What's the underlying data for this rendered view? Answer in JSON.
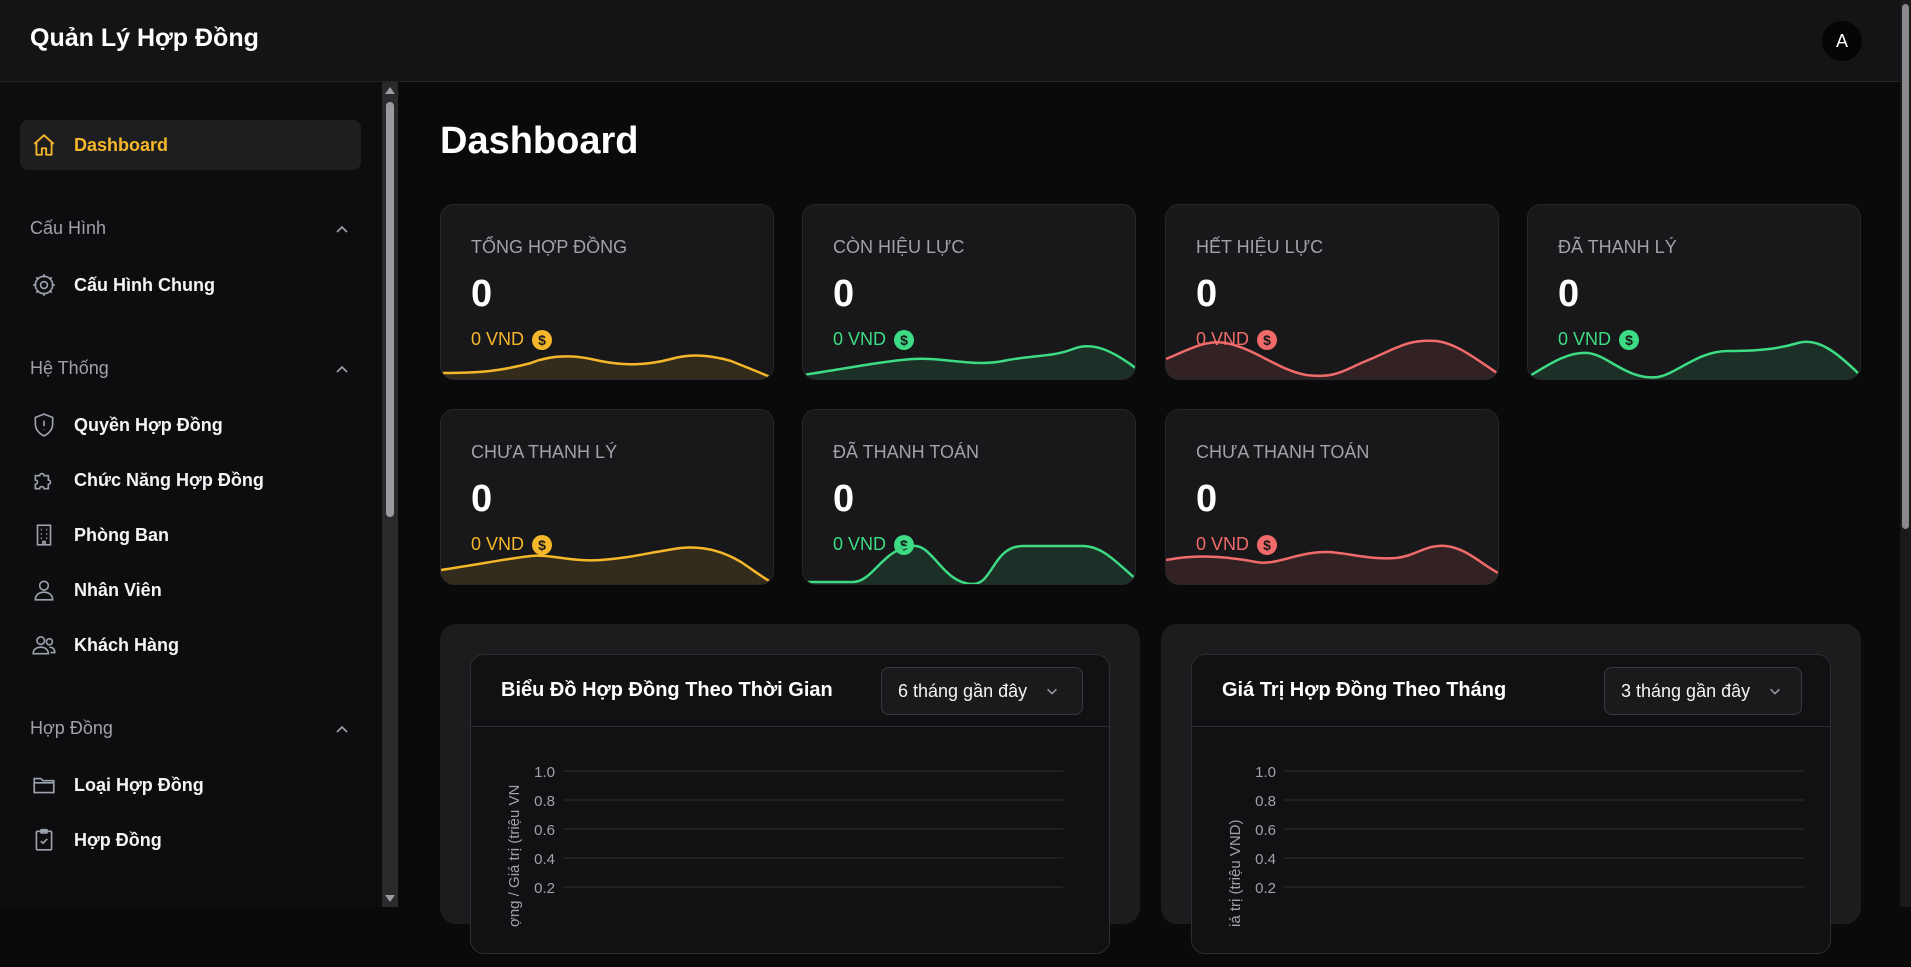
{
  "app": {
    "title": "Quản Lý Hợp Đồng",
    "avatar_initial": "A"
  },
  "sidebar": {
    "dashboard": {
      "label": "Dashboard",
      "icon": "home-icon"
    },
    "sections": [
      {
        "title": "Cấu Hình",
        "items": [
          {
            "label": "Cấu Hình Chung",
            "icon": "gear-icon"
          }
        ]
      },
      {
        "title": "Hệ Thống",
        "items": [
          {
            "label": "Quyền Hợp Đồng",
            "icon": "shield-icon"
          },
          {
            "label": "Chức Năng Hợp Đồng",
            "icon": "puzzle-icon"
          },
          {
            "label": "Phòng Ban",
            "icon": "building-icon"
          },
          {
            "label": "Nhân Viên",
            "icon": "user-icon"
          },
          {
            "label": "Khách Hàng",
            "icon": "users-icon"
          }
        ]
      },
      {
        "title": "Hợp Đồng",
        "items": [
          {
            "label": "Loại Hợp Đồng",
            "icon": "folder-icon"
          },
          {
            "label": "Hợp Đồng",
            "icon": "clipboard-check-icon"
          }
        ]
      }
    ]
  },
  "main": {
    "title": "Dashboard"
  },
  "colors": {
    "accent": "#f5b72a",
    "green": "#3ddc84",
    "red": "#f26b6b"
  },
  "cards": [
    {
      "label": "TỔNG HỢP ĐỒNG",
      "count": "0",
      "amount": "0 VND",
      "tone": "yellow"
    },
    {
      "label": "CÒN HIỆU LỰC",
      "count": "0",
      "amount": "0 VND",
      "tone": "green"
    },
    {
      "label": "HẾT HIỆU LỰC",
      "count": "0",
      "amount": "0 VND",
      "tone": "red"
    },
    {
      "label": "ĐÃ THANH LÝ",
      "count": "0",
      "amount": "0 VND",
      "tone": "green"
    },
    {
      "label": "CHƯA THANH LÝ",
      "count": "0",
      "amount": "0 VND",
      "tone": "yellow"
    },
    {
      "label": "ĐÃ THANH TOÁN",
      "count": "0",
      "amount": "0 VND",
      "tone": "green"
    },
    {
      "label": "CHƯA THANH TOÁN",
      "count": "0",
      "amount": "0 VND",
      "tone": "red"
    }
  ],
  "panels": [
    {
      "title": "Biểu Đồ Hợp Đồng Theo Thời Gian",
      "select": "6 tháng gần đây",
      "ylabel": "ợng / Giá trị (triệu VN"
    },
    {
      "title": "Giá Trị Hợp Đồng Theo Tháng",
      "select": "3 tháng gần đây",
      "ylabel": "iá trị (triệu VND)"
    }
  ],
  "chart_data": [
    {
      "type": "line",
      "title": "Biểu Đồ Hợp Đồng Theo Thời Gian",
      "ylabel": "ợng / Giá trị (triệu VN",
      "ylim": [
        0,
        1.0
      ],
      "yticks": [
        "0.2",
        "0.4",
        "0.6",
        "0.8",
        "1.0"
      ],
      "grid": true,
      "series": []
    },
    {
      "type": "bar",
      "title": "Giá Trị Hợp Đồng Theo Tháng",
      "ylabel": "iá trị (triệu VND)",
      "ylim": [
        0,
        1.0
      ],
      "yticks": [
        "0.2",
        "0.4",
        "0.6",
        "0.8",
        "1.0"
      ],
      "grid": true,
      "series": []
    }
  ]
}
